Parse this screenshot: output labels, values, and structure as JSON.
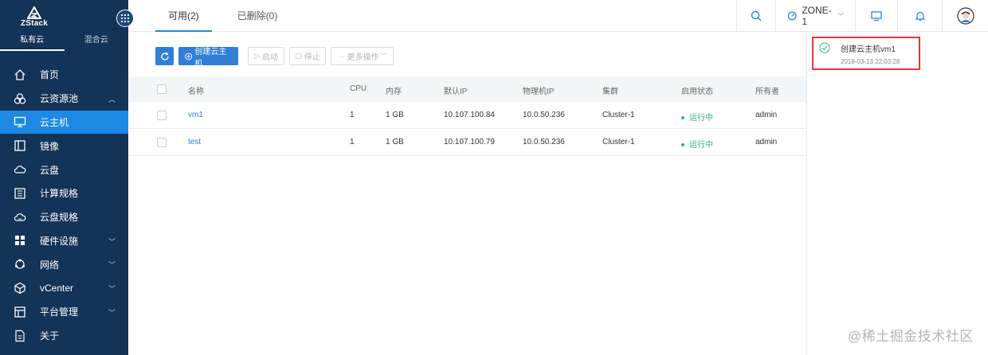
{
  "brand": {
    "logo_text": "ZStack"
  },
  "cloud_tabs": [
    {
      "label": "私有云"
    },
    {
      "label": "混合云"
    }
  ],
  "nav": [
    {
      "label": "首页",
      "icon": "home-icon"
    },
    {
      "label": "云资源池",
      "icon": "resource-pool-icon"
    },
    {
      "label": "云主机",
      "icon": "monitor-icon"
    },
    {
      "label": "镜像",
      "icon": "image-icon"
    },
    {
      "label": "云盘",
      "icon": "cloud-disk-icon"
    },
    {
      "label": "计算规格",
      "icon": "compute-spec-icon"
    },
    {
      "label": "云盘规格",
      "icon": "disk-spec-icon"
    },
    {
      "label": "硬件设施",
      "icon": "hardware-icon"
    },
    {
      "label": "网络",
      "icon": "network-icon"
    },
    {
      "label": "vCenter",
      "icon": "vcenter-icon"
    },
    {
      "label": "平台管理",
      "icon": "platform-icon"
    },
    {
      "label": "关于",
      "icon": "about-icon"
    }
  ],
  "tabs": [
    {
      "label": "可用(2)"
    },
    {
      "label": "已删除(0)"
    }
  ],
  "topbar": {
    "zone": "ZONE-1"
  },
  "toolbar": {
    "create_label": "创建云主机",
    "start_label": "启动",
    "stop_label": "停止",
    "more_label": "更多操作"
  },
  "table": {
    "headers": [
      "名称",
      "CPU",
      "内存",
      "默认IP",
      "物理机IP",
      "集群",
      "启用状态",
      "所有者"
    ],
    "rows": [
      {
        "name": "vm1",
        "cpu": "1",
        "memory": "1 GB",
        "default_ip": "10.107.100.84",
        "host_ip": "10.0.50.236",
        "cluster": "Cluster-1",
        "status": "运行中",
        "owner": "admin"
      },
      {
        "name": "test",
        "cpu": "1",
        "memory": "1 GB",
        "default_ip": "10.107.100.79",
        "host_ip": "10.0.50.236",
        "cluster": "Cluster-1",
        "status": "运行中",
        "owner": "admin"
      }
    ]
  },
  "notification": {
    "title": "创建云主机vm1",
    "time": "2018-03-13 22:03:28"
  },
  "watermark": "@稀土掘金技术社区",
  "colors": {
    "sidebar": "#133357",
    "accent": "#1e88e5",
    "status_running": "#2bb673",
    "highlight_border": "#e53935"
  }
}
